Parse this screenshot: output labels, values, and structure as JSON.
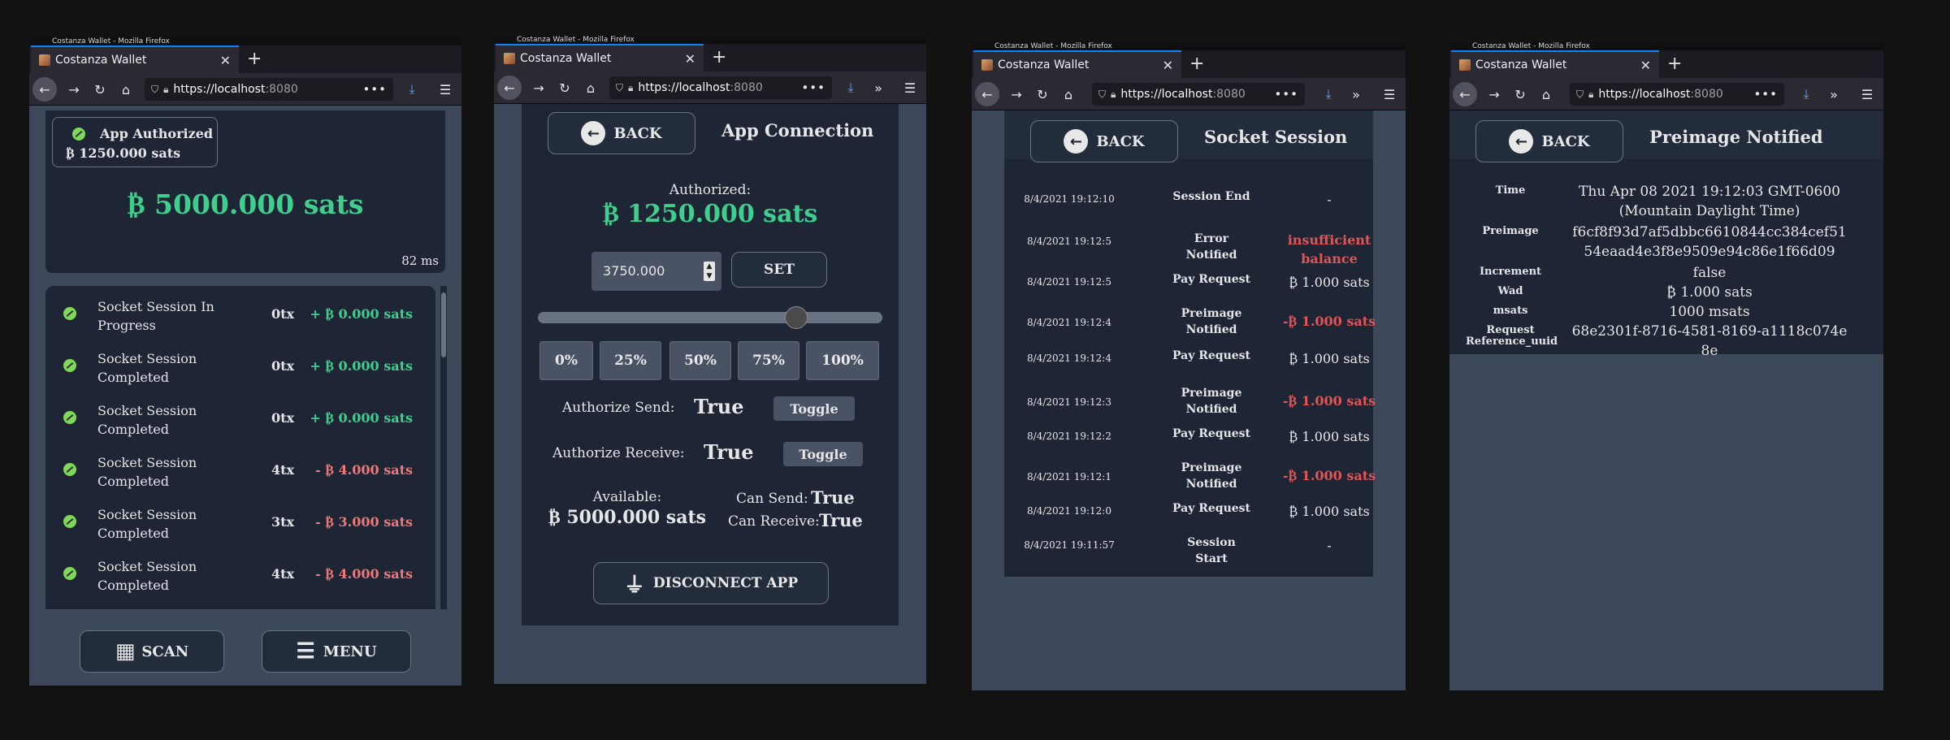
{
  "browser": {
    "window_title": "Costanza Wallet - Mozilla Firefox",
    "tab_title": "Costanza Wallet",
    "tab_close": "✕",
    "new_tab": "+",
    "url_host": "https://localhost",
    "url_port": ":8080",
    "url_more": "•••"
  },
  "screen1": {
    "notification_label": "App Authorized",
    "notification_amount": "₿ 1250.000 sats",
    "balance": "₿ 5000.000 sats",
    "latency": "82 ms",
    "transactions": [
      {
        "label": "Socket Session In Progress",
        "count": "0tx",
        "amount": "+ ₿ 0.000 sats",
        "sign": "positive"
      },
      {
        "label": "Socket Session Completed",
        "count": "0tx",
        "amount": "+ ₿ 0.000 sats",
        "sign": "positive"
      },
      {
        "label": "Socket Session Completed",
        "count": "0tx",
        "amount": "+ ₿ 0.000 sats",
        "sign": "positive"
      },
      {
        "label": "Socket Session Completed",
        "count": "4tx",
        "amount": "- ₿ 4.000 sats",
        "sign": "negative"
      },
      {
        "label": "Socket Session Completed",
        "count": "3tx",
        "amount": "- ₿ 3.000 sats",
        "sign": "negative"
      },
      {
        "label": "Socket Session Completed",
        "count": "4tx",
        "amount": "- ₿ 4.000 sats",
        "sign": "negative"
      }
    ],
    "scan_label": "SCAN",
    "menu_label": "MENU"
  },
  "screen2": {
    "back_label": "BACK",
    "title": "App Connection",
    "authorized_label": "Authorized:",
    "authorized_amount": "₿ 1250.000 sats",
    "amount_input": "3750.000",
    "set_label": "SET",
    "slider_fraction": 0.75,
    "percent_buttons": [
      "0%",
      "25%",
      "50%",
      "75%",
      "100%"
    ],
    "authorize_send_label": "Authorize Send:",
    "authorize_send_value": "True",
    "authorize_receive_label": "Authorize Receive:",
    "authorize_receive_value": "True",
    "toggle_label": "Toggle",
    "available_label": "Available:",
    "available_amount": "₿ 5000.000 sats",
    "can_send_label": "Can Send:",
    "can_send_value": "True",
    "can_receive_label": "Can Receive:",
    "can_receive_value": "True",
    "disconnect_label": "DISCONNECT APP"
  },
  "screen3": {
    "back_label": "BACK",
    "title": "Socket Session",
    "rows": [
      {
        "time": "8/4/2021 19:12:10",
        "event": "Session End",
        "value": "-",
        "style": "plain"
      },
      {
        "time": "8/4/2021 19:12:5",
        "event": "Error Notified",
        "value": "insufficient balance",
        "style": "error"
      },
      {
        "time": "8/4/2021 19:12:5",
        "event": "Pay Request",
        "value": "₿ 1.000 sats",
        "style": "plain"
      },
      {
        "time": "8/4/2021 19:12:4",
        "event": "Preimage Notified",
        "value": "-₿ 1.000 sats",
        "style": "debit"
      },
      {
        "time": "8/4/2021 19:12:4",
        "event": "Pay Request",
        "value": "₿ 1.000 sats",
        "style": "plain"
      },
      {
        "time": "8/4/2021 19:12:3",
        "event": "Preimage Notified",
        "value": "-₿ 1.000 sats",
        "style": "debit"
      },
      {
        "time": "8/4/2021 19:12:2",
        "event": "Pay Request",
        "value": "₿ 1.000 sats",
        "style": "plain"
      },
      {
        "time": "8/4/2021 19:12:1",
        "event": "Preimage Notified",
        "value": "-₿ 1.000 sats",
        "style": "debit"
      },
      {
        "time": "8/4/2021 19:12:0",
        "event": "Pay Request",
        "value": "₿ 1.000 sats",
        "style": "plain"
      },
      {
        "time": "8/4/2021 19:11:57",
        "event": "Session Start",
        "value": "-",
        "style": "plain"
      }
    ]
  },
  "screen4": {
    "back_label": "BACK",
    "title": "Preimage Notified",
    "fields": [
      {
        "key": "Time",
        "value": "Thu Apr 08 2021 19:12:03 GMT-0600 (Mountain Daylight Time)"
      },
      {
        "key": "Preimage",
        "value": "f6cf8f93d7af5dbbc6610844cc384cef5154eaad4e3f8e9509e94c86e1f66d09"
      },
      {
        "key": "Increment",
        "value": "false"
      },
      {
        "key": "Wad",
        "value": "₿ 1.000 sats"
      },
      {
        "key": "msats",
        "value": "1000 msats"
      },
      {
        "key": "Request Reference_uuid",
        "value": "68e2301f-8716-4581-8169-a1118c074e8e"
      }
    ]
  }
}
